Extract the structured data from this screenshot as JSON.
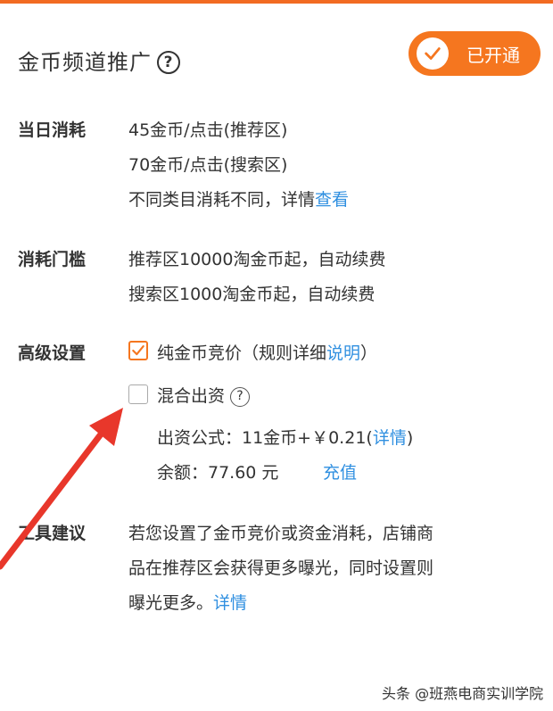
{
  "title": "金币频道推广",
  "title_help": "?",
  "status_button": "已开通",
  "daily_cost": {
    "label": "当日消耗",
    "line1": "45金币/点击(推荐区)",
    "line2": "70金币/点击(搜索区)",
    "line3": "不同类目消耗不同，详情",
    "line3_link": "查看"
  },
  "threshold": {
    "label": "消耗门槛",
    "line1": "推荐区10000淘金币起，自动续费",
    "line2": "搜索区1000淘金币起，自动续费"
  },
  "advanced": {
    "label": "高级设置",
    "option1": "纯金币竞价（规则详细",
    "option1_link": "说明",
    "option1_tail": "）",
    "option1_checked": true,
    "option2": "混合出资",
    "option2_checked": false,
    "option2_help": "?",
    "formula": "出资公式：11金币+￥0.21(",
    "formula_link": "详情",
    "formula_tail": ")",
    "balance": "余额：77.60 元",
    "recharge": "充值"
  },
  "tip": {
    "label": "工具建议",
    "line1": "若您设置了金币竞价或资金消耗，店铺商",
    "line2": "品在推荐区会获得更多曝光，同时设置则",
    "line3": "曝光更多。",
    "link": "详情"
  },
  "watermark": "头条 @班燕电商实训学院",
  "colors": {
    "accent": "#f5761f",
    "link": "#2f8fe0",
    "arrow": "#e8372b"
  }
}
